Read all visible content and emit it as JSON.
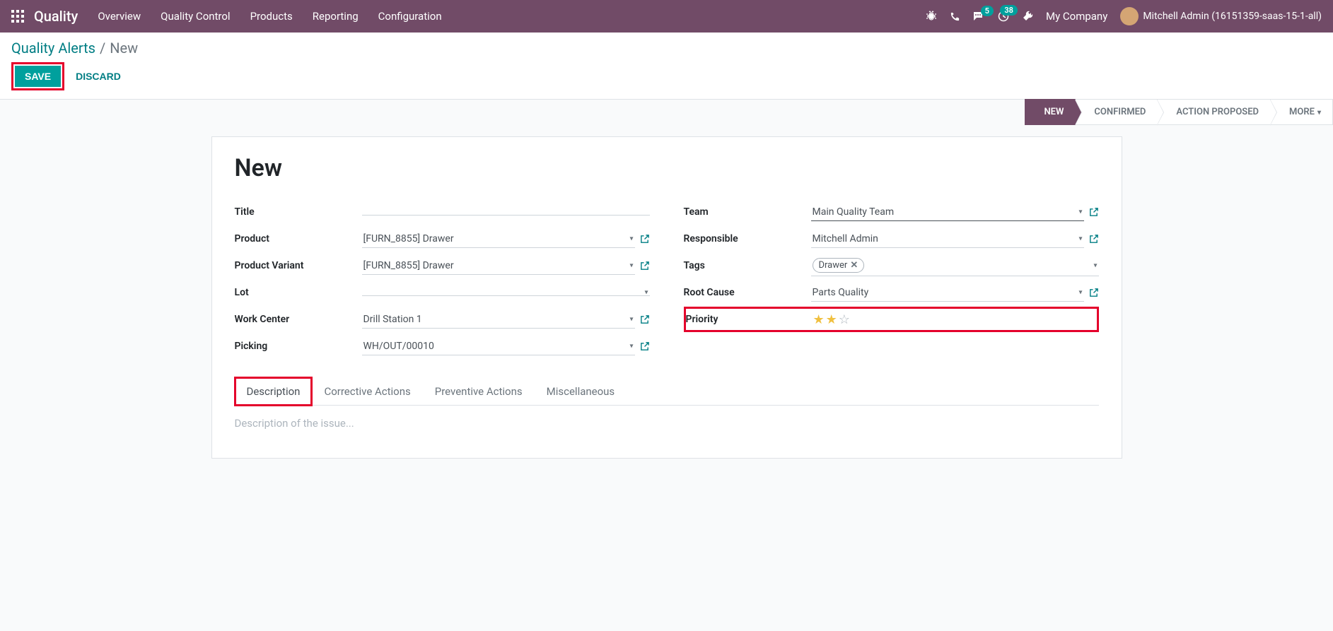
{
  "navbar": {
    "brand": "Quality",
    "menu": [
      "Overview",
      "Quality Control",
      "Products",
      "Reporting",
      "Configuration"
    ],
    "messages_badge": "5",
    "activities_badge": "38",
    "company": "My Company",
    "user": "Mitchell Admin (16151359-saas-15-1-all)"
  },
  "breadcrumb": {
    "parent": "Quality Alerts",
    "current": "New"
  },
  "buttons": {
    "save": "SAVE",
    "discard": "DISCARD"
  },
  "statusbar": [
    "NEW",
    "CONFIRMED",
    "ACTION PROPOSED",
    "MORE"
  ],
  "form": {
    "title": "New",
    "left": {
      "title_label": "Title",
      "title_value": "",
      "product_label": "Product",
      "product_value": "[FURN_8855] Drawer",
      "variant_label": "Product Variant",
      "variant_value": "[FURN_8855] Drawer",
      "lot_label": "Lot",
      "lot_value": "",
      "workcenter_label": "Work Center",
      "workcenter_value": "Drill Station 1",
      "picking_label": "Picking",
      "picking_value": "WH/OUT/00010"
    },
    "right": {
      "team_label": "Team",
      "team_value": "Main Quality Team",
      "responsible_label": "Responsible",
      "responsible_value": "Mitchell Admin",
      "tags_label": "Tags",
      "tags_value": "Drawer",
      "rootcause_label": "Root Cause",
      "rootcause_value": "Parts Quality",
      "priority_label": "Priority",
      "priority_value": 2
    }
  },
  "tabs": [
    "Description",
    "Corrective Actions",
    "Preventive Actions",
    "Miscellaneous"
  ],
  "description_placeholder": "Description of the issue..."
}
